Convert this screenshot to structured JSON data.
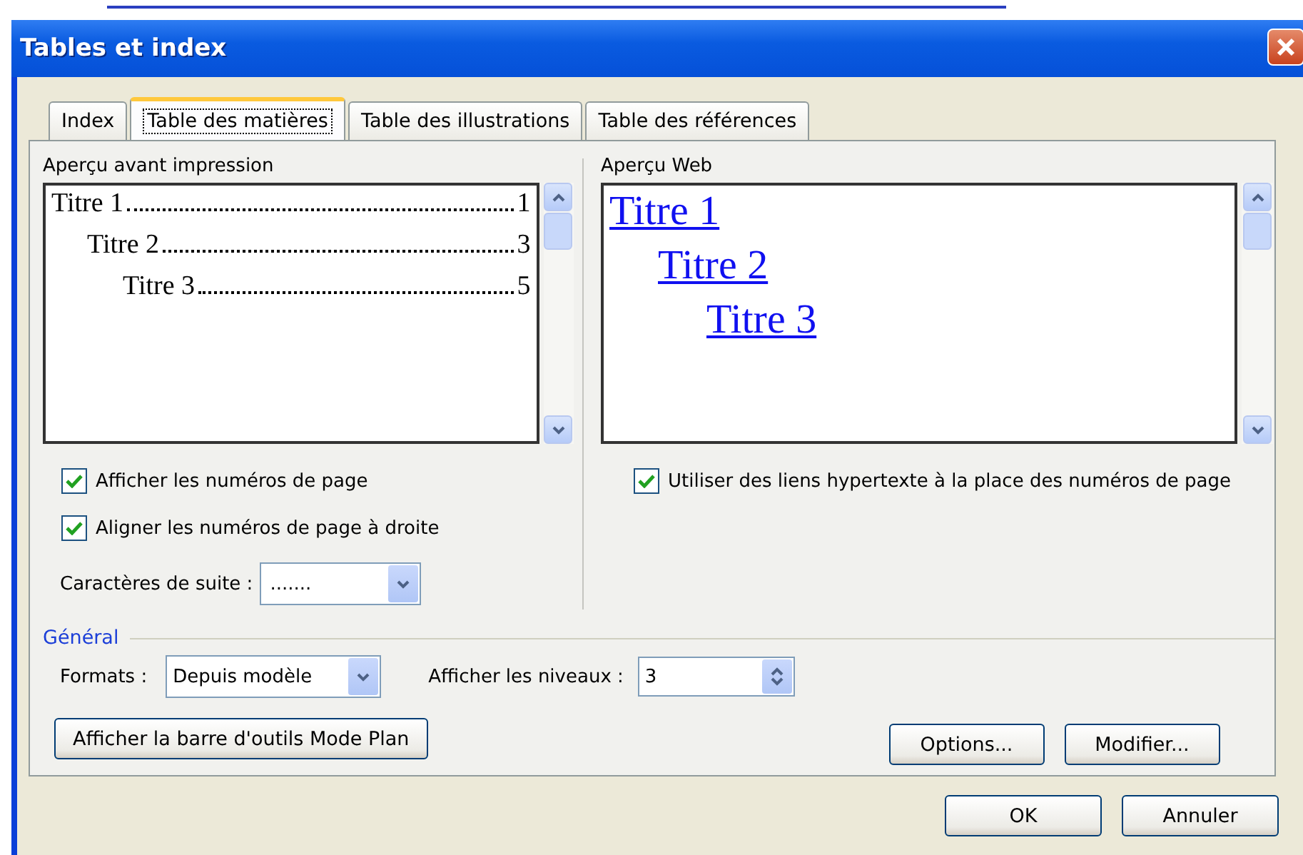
{
  "window": {
    "title": "Tables et index"
  },
  "tabs": [
    {
      "label": "Index",
      "selected": false
    },
    {
      "label": "Table des matières",
      "selected": true
    },
    {
      "label": "Table des illustrations",
      "selected": false
    },
    {
      "label": "Table des références",
      "selected": false
    }
  ],
  "print_preview": {
    "label": "Aperçu avant impression",
    "entries": [
      {
        "title": "Titre 1",
        "page": "1",
        "children": [
          {
            "title": "Titre 2",
            "page": "3",
            "children": [
              {
                "title": "Titre 3",
                "page": "5"
              }
            ]
          }
        ]
      }
    ]
  },
  "web_preview": {
    "label": "Aperçu Web",
    "entries": [
      {
        "title": "Titre 1",
        "children": [
          {
            "title": "Titre 2",
            "children": [
              {
                "title": "Titre 3"
              }
            ]
          }
        ]
      }
    ]
  },
  "left_options": [
    {
      "label": "Afficher les numéros de page",
      "checked": true
    },
    {
      "label": "Aligner les numéros de page à droite",
      "checked": true
    }
  ],
  "leader": {
    "label": "Caractères de suite :",
    "value": "......."
  },
  "web_option": {
    "label": "Utiliser des liens hypertexte à la place des numéros de page",
    "checked": true
  },
  "general": {
    "heading": "Général",
    "formats_label": "Formats :",
    "formats_value": "Depuis modèle",
    "levels_label": "Afficher les niveaux :",
    "levels_value": "3"
  },
  "panel_buttons": [
    "Afficher la barre d'outils Mode Plan",
    "Options...",
    "Modifier..."
  ],
  "dialog_buttons": [
    "OK",
    "Annuler"
  ]
}
